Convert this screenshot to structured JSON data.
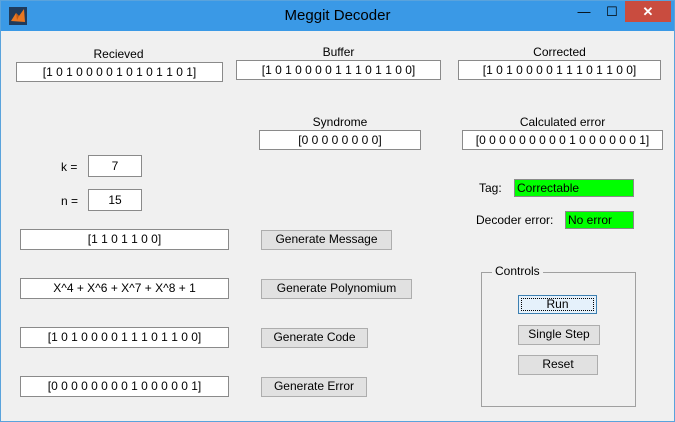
{
  "window": {
    "title": "Meggit Decoder",
    "icon": "matlab-icon",
    "minimize_glyph": "—",
    "maximize_glyph": "☐",
    "close_glyph": "✕"
  },
  "received": {
    "label": "Recieved",
    "value": "[1 0 1 0 0 0 0 1 0 1 0 1 1 0 1]"
  },
  "buffer": {
    "label": "Buffer",
    "value": "[1 0 1 0 0 0 0 1 1 1 0 1 1 0 0]"
  },
  "corrected": {
    "label": "Corrected",
    "value": "[1 0 1 0 0 0 0 1 1 1 0 1 1 0 0]"
  },
  "syndrome": {
    "label": "Syndrome",
    "value": "[0 0 0 0 0 0 0 0]"
  },
  "calculated_error": {
    "label": "Calculated error",
    "value": "[0 0 0 0 0 0 0 0 0 1 0 0 0 0 0 0 1]"
  },
  "k": {
    "label": "k =",
    "value": "7"
  },
  "n": {
    "label": "n =",
    "value": "15"
  },
  "tag": {
    "label": "Tag:",
    "value": "Correctable",
    "color": "#00ff00"
  },
  "decoder_error": {
    "label": "Decoder error:",
    "value": "No error",
    "color": "#00ff00"
  },
  "message": {
    "value": "[1 1 0 1 1 0 0]",
    "button": "Generate Message"
  },
  "polynomial": {
    "value": "X^4 + X^6 + X^7 + X^8 + 1",
    "button": "Generate Polynomium"
  },
  "code": {
    "value": "[1 0 1 0 0 0 0 1 1 1 0 1 1 0 0]",
    "button": "Generate Code"
  },
  "error": {
    "value": "[0 0 0 0 0 0 0 0 1 0 0 0 0 0 1]",
    "button": "Generate Error"
  },
  "controls": {
    "title": "Controls",
    "run": "Run",
    "single_step": "Single Step",
    "reset": "Reset"
  }
}
